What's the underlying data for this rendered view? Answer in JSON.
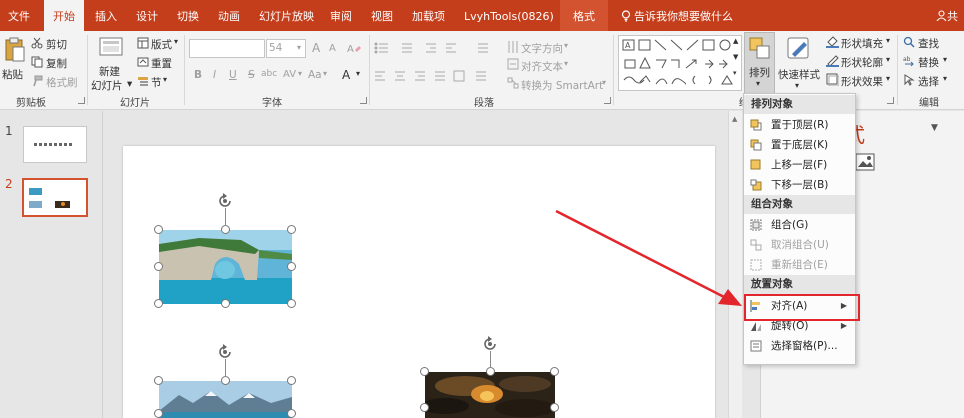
{
  "tabs": [
    "文件",
    "开始",
    "插入",
    "设计",
    "切换",
    "动画",
    "幻灯片放映",
    "审阅",
    "视图",
    "加载项",
    "LvyhTools(0826)",
    "格式"
  ],
  "active_tab": "开始",
  "tell_me": "告诉我你想要做什么",
  "share": "共",
  "clipboard": {
    "paste": "粘贴",
    "cut": "剪切",
    "copy": "复制",
    "format_painter": "格式刷",
    "label": "剪贴板"
  },
  "slides": {
    "new_slide": "新建",
    "new_slide2": "幻灯片",
    "layout": "版式",
    "reset": "重置",
    "section": "节",
    "label": "幻灯片"
  },
  "font": {
    "size": "54",
    "bold": "B",
    "italic": "I",
    "underline": "U",
    "strike": "S",
    "shadow": "abc",
    "spacing": "AV",
    "case": "Aa",
    "color": "A",
    "grow": "A",
    "shrink": "A",
    "label": "字体"
  },
  "paragraph": {
    "text_direction": "文字方向",
    "align_text": "对齐文本",
    "smartart": "转换为 SmartArt",
    "label": "段落"
  },
  "drawing": {
    "arrange": "排列",
    "quick_styles": "快速样式",
    "shape_fill": "形状填充",
    "shape_outline": "形状轮廓",
    "shape_effects": "形状效果",
    "label": "绘"
  },
  "editing": {
    "find": "查找",
    "replace": "替换",
    "select": "选择",
    "label": "编辑"
  },
  "thumbnails": [
    "1",
    "2"
  ],
  "right_pane": {
    "title": "式"
  },
  "menu": {
    "sections": [
      {
        "header": "排列对象",
        "items": [
          "置于顶层(R)",
          "置于底层(K)",
          "上移一层(F)",
          "下移一层(B)"
        ]
      },
      {
        "header": "组合对象",
        "items": [
          "组合(G)",
          "取消组合(U)",
          "重新组合(E)"
        ]
      },
      {
        "header": "放置对象",
        "items": [
          "对齐(A)",
          "旋转(O)",
          "选择窗格(P)..."
        ]
      }
    ]
  },
  "colors": {
    "brand": "#c43e1c",
    "highlight": "#e3262c"
  }
}
